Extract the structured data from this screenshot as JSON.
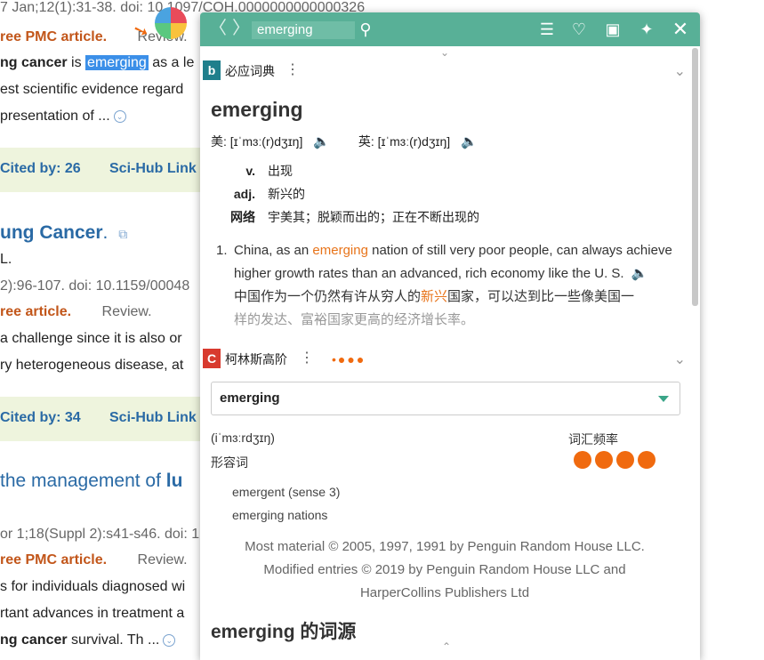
{
  "background": {
    "l1": "7 Jan;12(1):31-38. doi: 10.1097/COH.0000000000000326",
    "l2_orange": "ree PMC article.",
    "l2_gray": "Review.",
    "l3_bold": "ng cancer",
    "l3_is": " is ",
    "l3_hl": "emerging",
    "l3_rest": " as a le",
    "l4": "est scientific evidence regard",
    "l5": " presentation of ...",
    "cited1": "Cited by: 26",
    "scihub1": "Sci-Hub Link",
    "title2": "ung Cancer",
    "title2_dot": ".",
    "l6": "L.",
    "l7": "2):96-107. doi: 10.1159/00048",
    "l8_orange": "ree article.",
    "l8_gray": "Review.",
    "l9": " a challenge since it is also or",
    "l10": "ry heterogeneous disease, at",
    "cited2": "Cited by: 34",
    "scihub2": "Sci-Hub Link",
    "title3_a": " the management of ",
    "title3_b": "lu",
    "l11": "or 1;18(Suppl 2):s41-s46. doi: 1",
    "l12_orange": "ree PMC article.",
    "l12_gray": "Review.",
    "l13": "s for individuals diagnosed wi",
    "l14": "rtant advances in treatment a",
    "l15_bold": "ng cancer",
    "l15_rest": " survival. Th ..."
  },
  "toolbar": {
    "search_value": "emerging",
    "back": "〈",
    "forward": "〉"
  },
  "bing": {
    "name": "必应词典",
    "word": "emerging",
    "us_label": "美:",
    "us_phon": "[ɪˈmɜː(r)dʒɪŋ]",
    "uk_label": "英:",
    "uk_phon": "[ɪˈmɜː(r)dʒɪŋ]",
    "defs": [
      {
        "pos": "v.",
        "text": "出现"
      },
      {
        "pos": "adj.",
        "text": "新兴的"
      },
      {
        "pos": "网络",
        "text": "宇美其；脱颖而出的；正在不断出现的"
      }
    ],
    "example_num": "1.",
    "ex_a": "China, as an ",
    "ex_hl": "emerging",
    "ex_b": " nation of still very poor people, can always achieve higher growth rates than an advanced, rich economy like the U. S.",
    "ex_cn_a": "中国作为一个仍然有许从穷人的",
    "ex_cn_hl": "新兴",
    "ex_cn_b": "国家，可以达到比一些像美国一",
    "ex_cn_fade": "样的发达、富裕国家更高的经济增长率。"
  },
  "collins": {
    "name": "柯林斯高阶",
    "word": "emerging",
    "phon": "(iˈmɜːrdʒɪŋ)",
    "pos": "形容词",
    "freq_label": "词汇频率",
    "freq_level": 4,
    "forms": [
      "emergent (sense 3)",
      "emerging nations"
    ],
    "copyright_1": "Most material © 2005, 1997, 1991 by Penguin Random House LLC.",
    "copyright_2": "Modified entries © 2019 by Penguin Random House LLC and",
    "copyright_3": "HarperCollins Publishers Ltd",
    "etym_word": "emerging",
    "etym_label": " 的词源"
  },
  "colors": {
    "toolbar": "#58b097",
    "accent_orange": "#f06a0f",
    "link_blue": "#2a6aa5"
  }
}
